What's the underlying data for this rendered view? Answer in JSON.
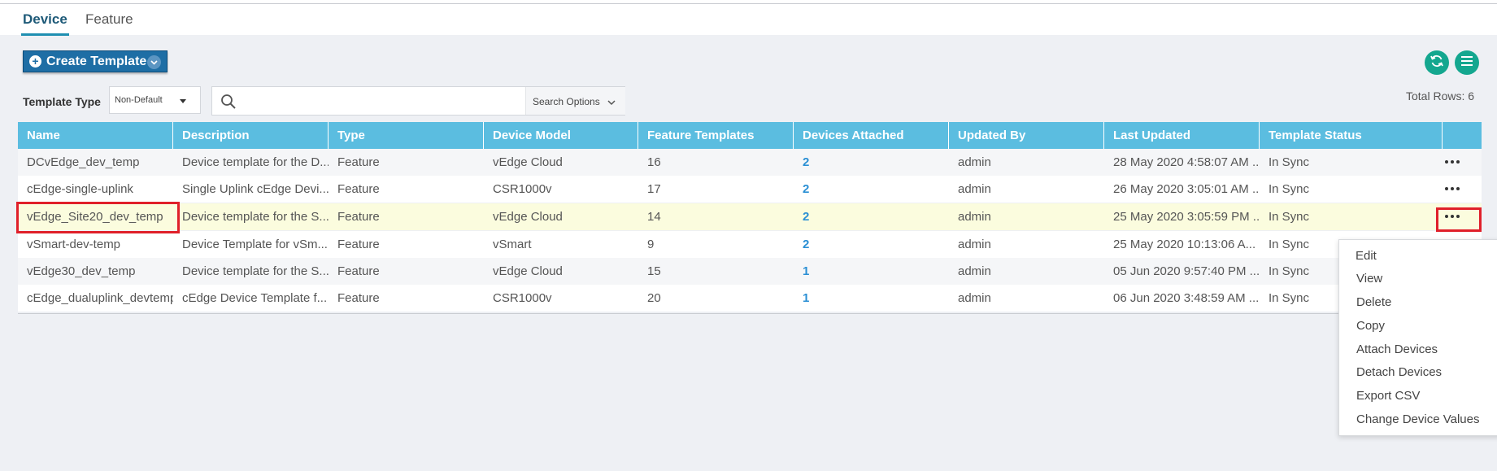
{
  "tabs": [
    {
      "label": "Device",
      "active": true
    },
    {
      "label": "Feature",
      "active": false
    }
  ],
  "toolbar": {
    "create_template_label": "Create Template",
    "template_type_label": "Template Type",
    "template_type_value": "Non-Default",
    "search_placeholder": "",
    "search_options_label": "Search Options",
    "total_rows": "Total Rows: 6"
  },
  "table": {
    "columns": [
      "Name",
      "Description",
      "Type",
      "Device Model",
      "Feature Templates",
      "Devices Attached",
      "Updated By",
      "Last Updated",
      "Template Status"
    ],
    "rows": [
      {
        "name": "DCvEdge_dev_temp",
        "description": "Device template for the D...",
        "type": "Feature",
        "device_model": "vEdge Cloud",
        "feature_templates": "16",
        "devices_attached": "2",
        "updated_by": "admin",
        "last_updated": "28 May 2020 4:58:07 AM ...",
        "status": "In Sync"
      },
      {
        "name": "cEdge-single-uplink",
        "description": "Single Uplink cEdge Devi...",
        "type": "Feature",
        "device_model": "CSR1000v",
        "feature_templates": "17",
        "devices_attached": "2",
        "updated_by": "admin",
        "last_updated": "26 May 2020 3:05:01 AM ...",
        "status": "In Sync"
      },
      {
        "name": "vEdge_Site20_dev_temp",
        "description": "Device template for the S...",
        "type": "Feature",
        "device_model": "vEdge Cloud",
        "feature_templates": "14",
        "devices_attached": "2",
        "updated_by": "admin",
        "last_updated": "25 May 2020 3:05:59 PM ...",
        "status": "In Sync"
      },
      {
        "name": "vSmart-dev-temp",
        "description": "Device Template for vSm...",
        "type": "Feature",
        "device_model": "vSmart",
        "feature_templates": "9",
        "devices_attached": "2",
        "updated_by": "admin",
        "last_updated": "25 May 2020 10:13:06 A...",
        "status": "In Sync"
      },
      {
        "name": "vEdge30_dev_temp",
        "description": "Device template for the S...",
        "type": "Feature",
        "device_model": "vEdge Cloud",
        "feature_templates": "15",
        "devices_attached": "1",
        "updated_by": "admin",
        "last_updated": "05 Jun 2020 9:57:40 PM ...",
        "status": "In Sync"
      },
      {
        "name": "cEdge_dualuplink_devtemp",
        "description": "cEdge Device Template f...",
        "type": "Feature",
        "device_model": "CSR1000v",
        "feature_templates": "20",
        "devices_attached": "1",
        "updated_by": "admin",
        "last_updated": "06 Jun 2020 3:48:59 AM ...",
        "status": "In Sync"
      }
    ]
  },
  "context_menu": {
    "items": [
      "Edit",
      "View",
      "Delete",
      "Copy",
      "Attach Devices",
      "Detach Devices",
      "Export CSV",
      "Change Device Values"
    ]
  },
  "colors": {
    "accent_teal": "#14a78f",
    "header_blue": "#5bbde0",
    "button_blue": "#1e6ea5",
    "link_blue": "#2a8fd4",
    "highlight_red": "#e0202a",
    "selected_row": "#fbfcde"
  },
  "icons": [
    "plus-circle-icon",
    "chevron-down-icon",
    "refresh-icon",
    "hamburger-menu-icon",
    "search-icon",
    "more-options-icon"
  ]
}
